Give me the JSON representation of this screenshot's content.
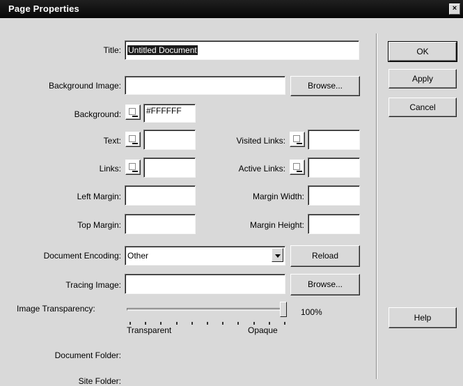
{
  "window": {
    "title": "Page Properties",
    "close_glyph": "×"
  },
  "labels": {
    "title": "Title:",
    "background_image": "Background Image:",
    "background": "Background:",
    "text": "Text:",
    "visited_links": "Visited Links:",
    "links": "Links:",
    "active_links": "Active Links:",
    "left_margin": "Left Margin:",
    "margin_width": "Margin Width:",
    "top_margin": "Top Margin:",
    "margin_height": "Margin Height:",
    "document_encoding": "Document Encoding:",
    "tracing_image": "Tracing Image:",
    "image_transparency": "Image Transparency:",
    "document_folder": "Document Folder:",
    "site_folder": "Site Folder:"
  },
  "fields": {
    "title": "Untitled Document",
    "background_image": "",
    "background_color": "#FFFFFF",
    "text_color": "",
    "visited_links_color": "",
    "links_color": "",
    "active_links_color": "",
    "left_margin": "",
    "margin_width": "",
    "top_margin": "",
    "margin_height": "",
    "document_encoding": "Other",
    "tracing_image": ""
  },
  "buttons": {
    "ok": "OK",
    "apply": "Apply",
    "cancel": "Cancel",
    "help": "Help",
    "browse": "Browse...",
    "reload": "Reload"
  },
  "slider": {
    "value_text": "100%",
    "value_fraction": 1.0,
    "min_label": "Transparent",
    "max_label": "Opaque"
  }
}
